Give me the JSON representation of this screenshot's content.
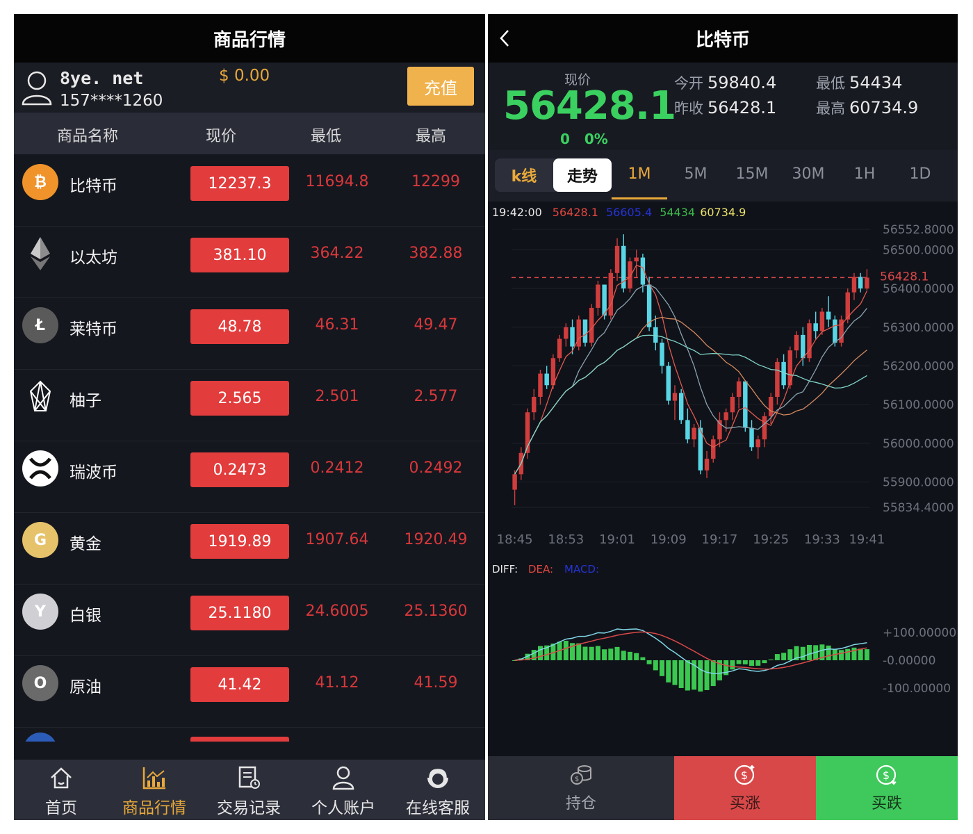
{
  "market": {
    "title": "商品行情",
    "user": {
      "site": "8ye. net",
      "phone": "157****1260",
      "balance": "$ 0.00",
      "recharge_label": "充值"
    },
    "columns": [
      "商品名称",
      "现价",
      "最低",
      "最高"
    ],
    "rows": [
      {
        "name": "比特币",
        "price": "12237.3",
        "low": "11694.8",
        "high": "12299",
        "icon": "bitcoin-icon",
        "icon_text": "₿",
        "color": "#f0932b"
      },
      {
        "name": "以太坊",
        "price": "381.10",
        "low": "364.22",
        "high": "382.88",
        "icon": "ethereum-icon",
        "icon_text": "",
        "color": "#15171f"
      },
      {
        "name": "莱特币",
        "price": "48.78",
        "low": "46.31",
        "high": "49.47",
        "icon": "litecoin-icon",
        "icon_text": "Ł",
        "color": "#5a5a5a"
      },
      {
        "name": "柚子",
        "price": "2.565",
        "low": "2.501",
        "high": "2.577",
        "icon": "eos-icon",
        "icon_text": "",
        "color": "#15171f"
      },
      {
        "name": "瑞波币",
        "price": "0.2473",
        "low": "0.2412",
        "high": "0.2492",
        "icon": "ripple-icon",
        "icon_text": "",
        "color": "#ffffff"
      },
      {
        "name": "黄金",
        "price": "1919.89",
        "low": "1907.64",
        "high": "1920.49",
        "icon": "gold-icon",
        "icon_text": "G",
        "color": "#e6c26b"
      },
      {
        "name": "白银",
        "price": "25.1180",
        "low": "24.6005",
        "high": "25.1360",
        "icon": "silver-icon",
        "icon_text": "Y",
        "color": "#cfcfd4"
      },
      {
        "name": "原油",
        "price": "41.42",
        "low": "41.12",
        "high": "41.59",
        "icon": "crude-oil-icon",
        "icon_text": "O",
        "color": "#6a6a6a"
      }
    ],
    "tabs": [
      {
        "label": "首页",
        "icon": "home-icon"
      },
      {
        "label": "商品行情",
        "icon": "market-chart-icon",
        "active": true
      },
      {
        "label": "交易记录",
        "icon": "records-icon"
      },
      {
        "label": "个人账户",
        "icon": "user-icon"
      },
      {
        "label": "在线客服",
        "icon": "customer-service-icon"
      }
    ]
  },
  "detail": {
    "title": "比特币",
    "price_label": "现价",
    "price": "56428.1",
    "change": "0",
    "change_pct": "0%",
    "open_label": "今开",
    "open": "59840.4",
    "prev_close_label": "昨收",
    "prev_close": "56428.1",
    "low_label": "最低",
    "low": "54434",
    "high_label": "最高",
    "high": "60734.9",
    "seg_kline": "k线",
    "seg_trend": "走势",
    "periods": [
      "1M",
      "5M",
      "15M",
      "30M",
      "1H",
      "1D"
    ],
    "active_period": "1M",
    "info": {
      "time": "19:42:00",
      "v1": "56428.1",
      "v2": "56605.4",
      "v3": "54434",
      "v4": "60734.9"
    },
    "price_axis": [
      "56552.8000",
      "56500.0000",
      "56400.0000",
      "56300.0000",
      "56200.0000",
      "56100.0000",
      "56000.0000",
      "55900.0000",
      "55834.4000"
    ],
    "current_line_label": "56428.1",
    "time_axis": [
      "18:45",
      "18:53",
      "19:01",
      "19:09",
      "19:17",
      "19:25",
      "19:33",
      "19:41"
    ],
    "macd_legend": {
      "diff": "DIFF:",
      "dea": "DEA:",
      "macd": "MACD:"
    },
    "macd_axis": [
      "+100.00000",
      "-0.00000",
      "-100.00000"
    ],
    "buttons": {
      "hold": "持仓",
      "buy_up": "买涨",
      "buy_down": "买跌"
    }
  },
  "chart_data": {
    "type": "candlestick",
    "x": [
      "18:45",
      "18:46",
      "18:47",
      "18:48",
      "18:49",
      "18:50",
      "18:51",
      "18:52",
      "18:53",
      "18:54",
      "18:55",
      "18:56",
      "18:57",
      "18:58",
      "18:59",
      "19:00",
      "19:01",
      "19:02",
      "19:03",
      "19:04",
      "19:05",
      "19:06",
      "19:07",
      "19:08",
      "19:09",
      "19:10",
      "19:11",
      "19:12",
      "19:13",
      "19:14",
      "19:15",
      "19:16",
      "19:17",
      "19:18",
      "19:19",
      "19:20",
      "19:21",
      "19:22",
      "19:23",
      "19:24",
      "19:25",
      "19:26",
      "19:27",
      "19:28",
      "19:29",
      "19:30",
      "19:31",
      "19:32",
      "19:33",
      "19:34",
      "19:35",
      "19:36",
      "19:37",
      "19:38",
      "19:39",
      "19:40",
      "19:41",
      "19:42"
    ],
    "ohlc": [
      [
        55880,
        55930,
        55840,
        55920
      ],
      [
        55920,
        55990,
        55905,
        55975
      ],
      [
        55975,
        56090,
        55960,
        56080
      ],
      [
        56080,
        56140,
        56060,
        56120
      ],
      [
        56120,
        56190,
        56100,
        56180
      ],
      [
        56180,
        56200,
        56140,
        56150
      ],
      [
        56150,
        56230,
        56140,
        56220
      ],
      [
        56220,
        56280,
        56210,
        56270
      ],
      [
        56270,
        56310,
        56250,
        56300
      ],
      [
        56300,
        56320,
        56230,
        56250
      ],
      [
        56250,
        56330,
        56240,
        56320
      ],
      [
        56320,
        56310,
        56250,
        56260
      ],
      [
        56260,
        56360,
        56250,
        56350
      ],
      [
        56350,
        56420,
        56330,
        56410
      ],
      [
        56410,
        56390,
        56320,
        56330
      ],
      [
        56330,
        56450,
        56320,
        56440
      ],
      [
        56440,
        56530,
        56420,
        56510
      ],
      [
        56510,
        56540,
        56390,
        56400
      ],
      [
        56400,
        56480,
        56390,
        56470
      ],
      [
        56470,
        56500,
        56430,
        56480
      ],
      [
        56480,
        56490,
        56390,
        56410
      ],
      [
        56410,
        56430,
        56290,
        56300
      ],
      [
        56300,
        56330,
        56240,
        56260
      ],
      [
        56260,
        56270,
        56180,
        56200
      ],
      [
        56200,
        56210,
        56100,
        56110
      ],
      [
        56110,
        56150,
        56060,
        56130
      ],
      [
        56130,
        56140,
        56050,
        56060
      ],
      [
        56060,
        56090,
        56000,
        56010
      ],
      [
        56010,
        56050,
        55990,
        56040
      ],
      [
        56040,
        56060,
        55920,
        55930
      ],
      [
        55930,
        55980,
        55910,
        55960
      ],
      [
        55960,
        56020,
        55950,
        56010
      ],
      [
        56010,
        56080,
        55990,
        56060
      ],
      [
        56060,
        56090,
        56030,
        56080
      ],
      [
        56080,
        56130,
        56060,
        56120
      ],
      [
        56120,
        56170,
        56090,
        56160
      ],
      [
        56160,
        56150,
        56030,
        56040
      ],
      [
        56040,
        56060,
        55980,
        55990
      ],
      [
        55990,
        56020,
        55960,
        56010
      ],
      [
        56010,
        56080,
        55990,
        56070
      ],
      [
        56070,
        56130,
        56050,
        56120
      ],
      [
        56120,
        56220,
        56100,
        56210
      ],
      [
        56210,
        56230,
        56140,
        56150
      ],
      [
        56150,
        56250,
        56140,
        56240
      ],
      [
        56240,
        56290,
        56220,
        56280
      ],
      [
        56280,
        56300,
        56200,
        56220
      ],
      [
        56220,
        56320,
        56210,
        56310
      ],
      [
        56310,
        56340,
        56270,
        56290
      ],
      [
        56290,
        56350,
        56280,
        56340
      ],
      [
        56340,
        56380,
        56300,
        56320
      ],
      [
        56320,
        56330,
        56250,
        56260
      ],
      [
        56260,
        56330,
        56250,
        56320
      ],
      [
        56320,
        56400,
        56310,
        56390
      ],
      [
        56390,
        56440,
        56370,
        56430
      ],
      [
        56430,
        56440,
        56390,
        56400
      ],
      [
        56400,
        56450,
        56395,
        56428
      ]
    ],
    "ylim": [
      55834.4,
      56552.8
    ]
  }
}
